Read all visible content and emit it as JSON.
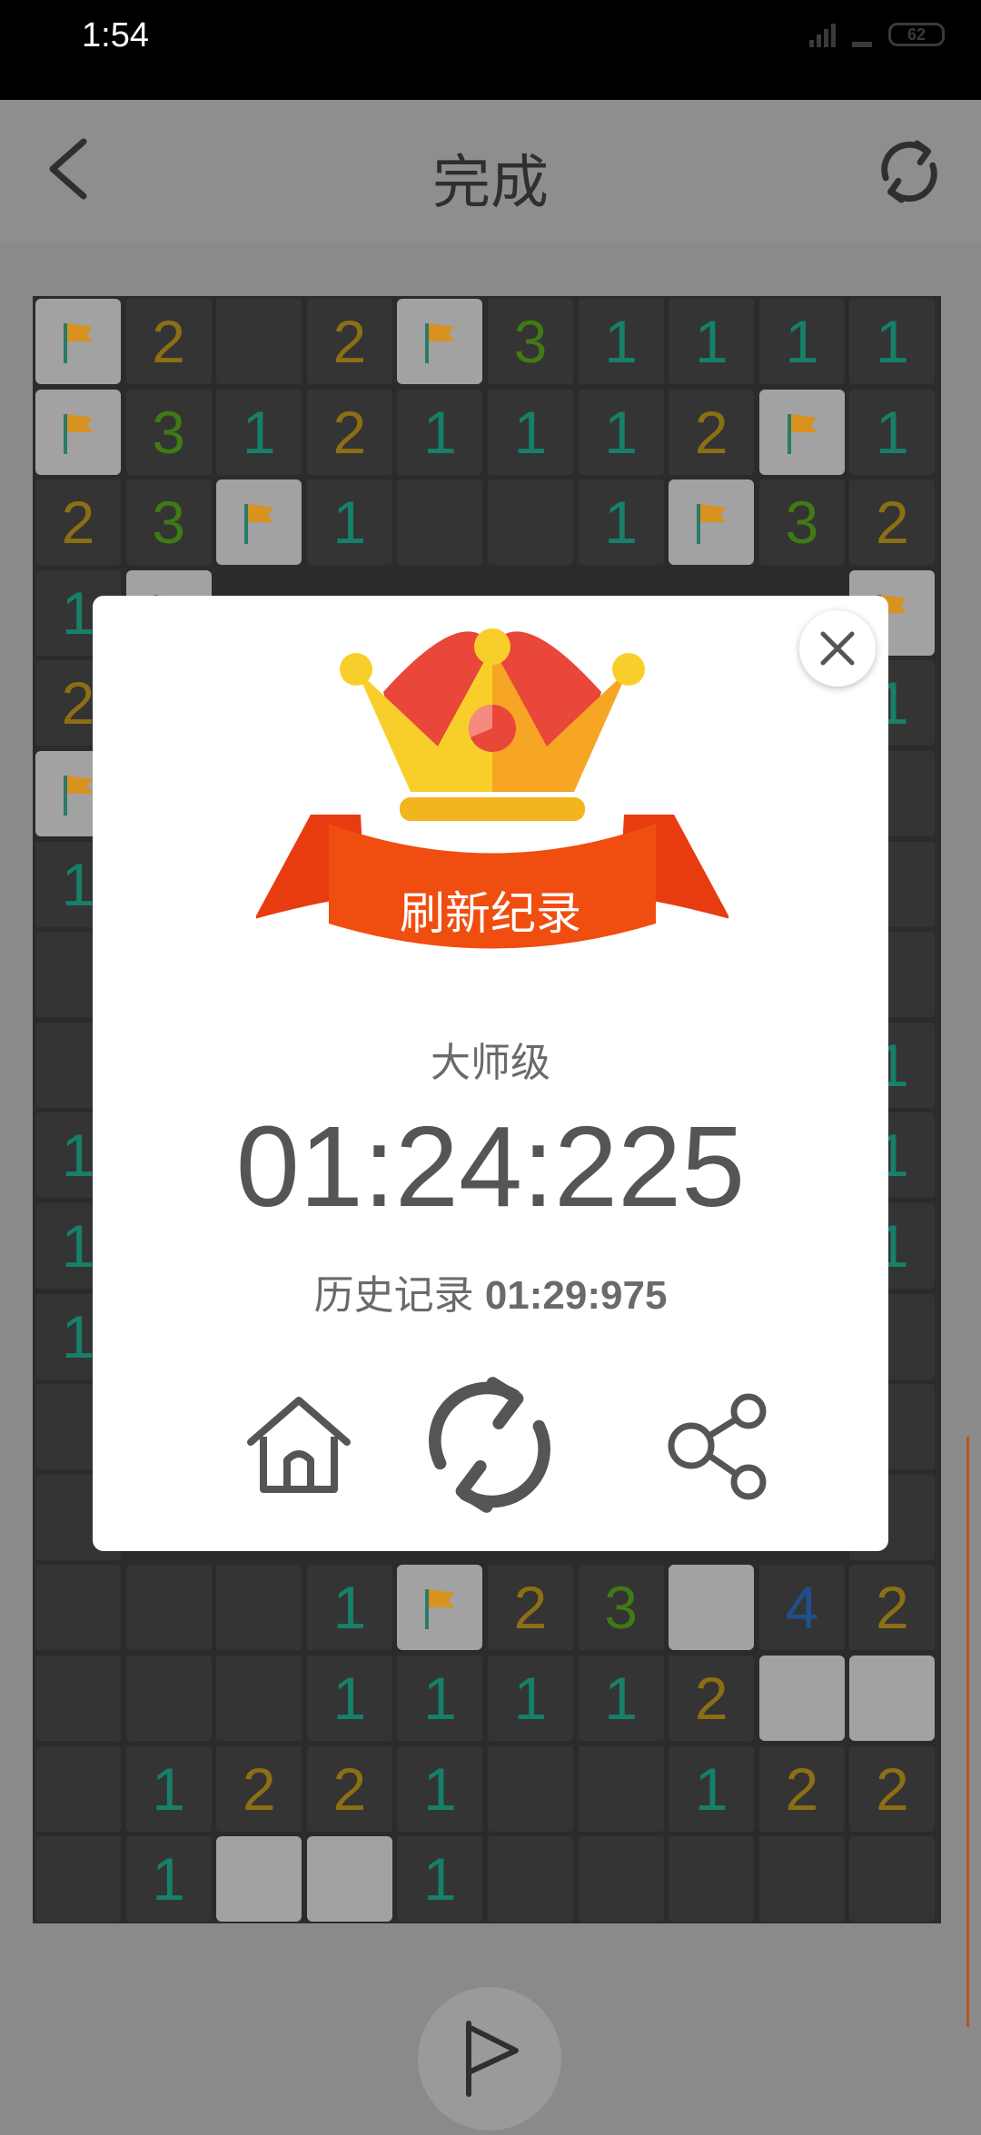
{
  "status_bar": {
    "time": "1:54",
    "battery": "62"
  },
  "header": {
    "title": "完成",
    "back_icon": "chevron-left-icon",
    "restart_icon": "refresh-icon"
  },
  "board": {
    "rows": [
      [
        "F",
        "2",
        "E",
        "2",
        "F",
        "3",
        "1",
        "1",
        "1",
        "1"
      ],
      [
        "F",
        "3",
        "1",
        "2",
        "1",
        "1",
        "1",
        "2",
        "F",
        "1"
      ],
      [
        "2",
        "3",
        "F",
        "1",
        "E",
        "E",
        "1",
        "F",
        "3",
        "2"
      ],
      [
        "1",
        "F",
        "",
        "",
        "",
        "",
        "",
        "",
        "",
        "F"
      ],
      [
        "2",
        "",
        "",
        "",
        "",
        "",
        "",
        "",
        "",
        "1"
      ],
      [
        "F",
        "",
        "",
        "",
        "",
        "",
        "",
        "",
        "",
        "E"
      ],
      [
        "1",
        "",
        "",
        "",
        "",
        "",
        "",
        "",
        "",
        "E"
      ],
      [
        "E",
        "",
        "",
        "",
        "",
        "",
        "",
        "",
        "",
        "E"
      ],
      [
        "E",
        "",
        "",
        "",
        "",
        "",
        "",
        "",
        "",
        "1"
      ],
      [
        "1",
        "",
        "",
        "",
        "",
        "",
        "",
        "",
        "",
        "1"
      ],
      [
        "1",
        "",
        "",
        "",
        "",
        "",
        "",
        "",
        "",
        "1"
      ],
      [
        "1",
        "",
        "",
        "",
        "",
        "",
        "",
        "",
        "",
        "E"
      ],
      [
        "E",
        "",
        "",
        "",
        "",
        "",
        "",
        "",
        "",
        "E"
      ],
      [
        "E",
        "",
        "",
        "",
        "",
        "",
        "",
        "",
        "",
        "E"
      ],
      [
        "E",
        "E",
        "E",
        "1",
        "F",
        "2",
        "3",
        "H",
        "4",
        "2"
      ],
      [
        "E",
        "E",
        "E",
        "1",
        "1",
        "1",
        "1",
        "2",
        "H",
        "H"
      ],
      [
        "E",
        "1",
        "2",
        "2",
        "1",
        "E",
        "E",
        "1",
        "2",
        "2"
      ],
      [
        "E",
        "1",
        "H",
        "H",
        "1",
        "E",
        "E",
        "E",
        "E",
        "E"
      ]
    ],
    "colors": {
      "1": "#16806a",
      "2": "#8c6f14",
      "3": "#3f7a14",
      "4": "#1f4f8e"
    }
  },
  "dialog": {
    "badge_text": "刷新纪录",
    "difficulty": "大师级",
    "current_time": "01:24:225",
    "history_label": "历史记录",
    "history_time": "01:29:975",
    "buttons": [
      "home-icon",
      "replay-icon",
      "share-icon"
    ],
    "close_icon": "close-icon"
  },
  "flag_mode_icon": "flag-outline-icon",
  "colors": {
    "ribbon": "#e83c10",
    "crown_gold": "#f8cf2a",
    "crown_red": "#e8473a"
  }
}
